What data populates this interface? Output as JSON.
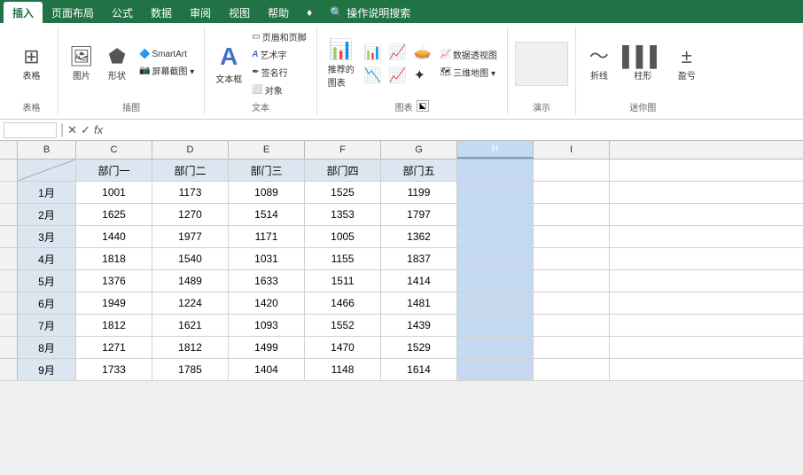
{
  "ribbon": {
    "tabs": [
      {
        "label": "插入",
        "active": true
      },
      {
        "label": "页面布局"
      },
      {
        "label": "公式"
      },
      {
        "label": "数据"
      },
      {
        "label": "审阅"
      },
      {
        "label": "视图"
      },
      {
        "label": "帮助"
      },
      {
        "label": "♦"
      },
      {
        "label": "操作说明搜索"
      }
    ],
    "groups": [
      {
        "name": "tables",
        "items_row1": [
          {
            "label": "表格",
            "icon": "⊞"
          }
        ],
        "label": "表格"
      },
      {
        "name": "illustrations",
        "items": [
          {
            "label": "图片",
            "icon": "🖼"
          },
          {
            "label": "形状",
            "icon": "⬟"
          },
          {
            "label": "SmartArt",
            "icon": "SmartArt"
          },
          {
            "label": "屏幕截图▼",
            "icon": "📷"
          }
        ],
        "label": "插图"
      },
      {
        "name": "text",
        "items": [
          {
            "label": "文本框",
            "icon": "A"
          },
          {
            "label": "页眉和页脚",
            "icon": "▭"
          },
          {
            "label": "艺术字",
            "icon": "A"
          },
          {
            "label": "签名行",
            "icon": "✒"
          },
          {
            "label": "对象",
            "icon": "⬜"
          }
        ],
        "label": "文本"
      },
      {
        "name": "charts",
        "items": [
          {
            "label": "推荐的图表",
            "icon": "📊"
          },
          {
            "label": "数据透视图",
            "icon": "📈"
          },
          {
            "label": "三维地图▼",
            "icon": "🗺"
          }
        ],
        "label": "图表"
      },
      {
        "name": "sparklines",
        "items": [
          {
            "label": "折线",
            "icon": "〜"
          },
          {
            "label": "柱形",
            "icon": "▌"
          },
          {
            "label": "盈亏",
            "icon": "±"
          }
        ],
        "label": "迷你图"
      }
    ]
  },
  "formula_bar": {
    "name_box": "",
    "icons": [
      "✕",
      "✓",
      "fx"
    ]
  },
  "spreadsheet": {
    "col_headers": [
      "B",
      "C",
      "D",
      "E",
      "F",
      "G",
      "H",
      "I"
    ],
    "header_row": {
      "cells": [
        "",
        "部门一",
        "部门二",
        "部门三",
        "部门四",
        "部门五",
        "",
        ""
      ]
    },
    "rows": [
      {
        "month": "1月",
        "data": [
          1001,
          1173,
          1089,
          1525,
          1199
        ]
      },
      {
        "month": "2月",
        "data": [
          1625,
          1270,
          1514,
          1353,
          1797
        ]
      },
      {
        "month": "3月",
        "data": [
          1440,
          1977,
          1171,
          1005,
          1362
        ]
      },
      {
        "month": "4月",
        "data": [
          1818,
          1540,
          1031,
          1155,
          1837
        ]
      },
      {
        "month": "5月",
        "data": [
          1376,
          1489,
          1633,
          1511,
          1414
        ]
      },
      {
        "month": "6月",
        "data": [
          1949,
          1224,
          1420,
          1466,
          1481
        ]
      },
      {
        "month": "7月",
        "data": [
          1812,
          1621,
          1093,
          1552,
          1439
        ]
      },
      {
        "month": "8月",
        "data": [
          1271,
          1812,
          1499,
          1470,
          1529
        ]
      },
      {
        "month": "9月",
        "data": [
          1733,
          1785,
          1404,
          1148,
          1614
        ]
      }
    ]
  }
}
